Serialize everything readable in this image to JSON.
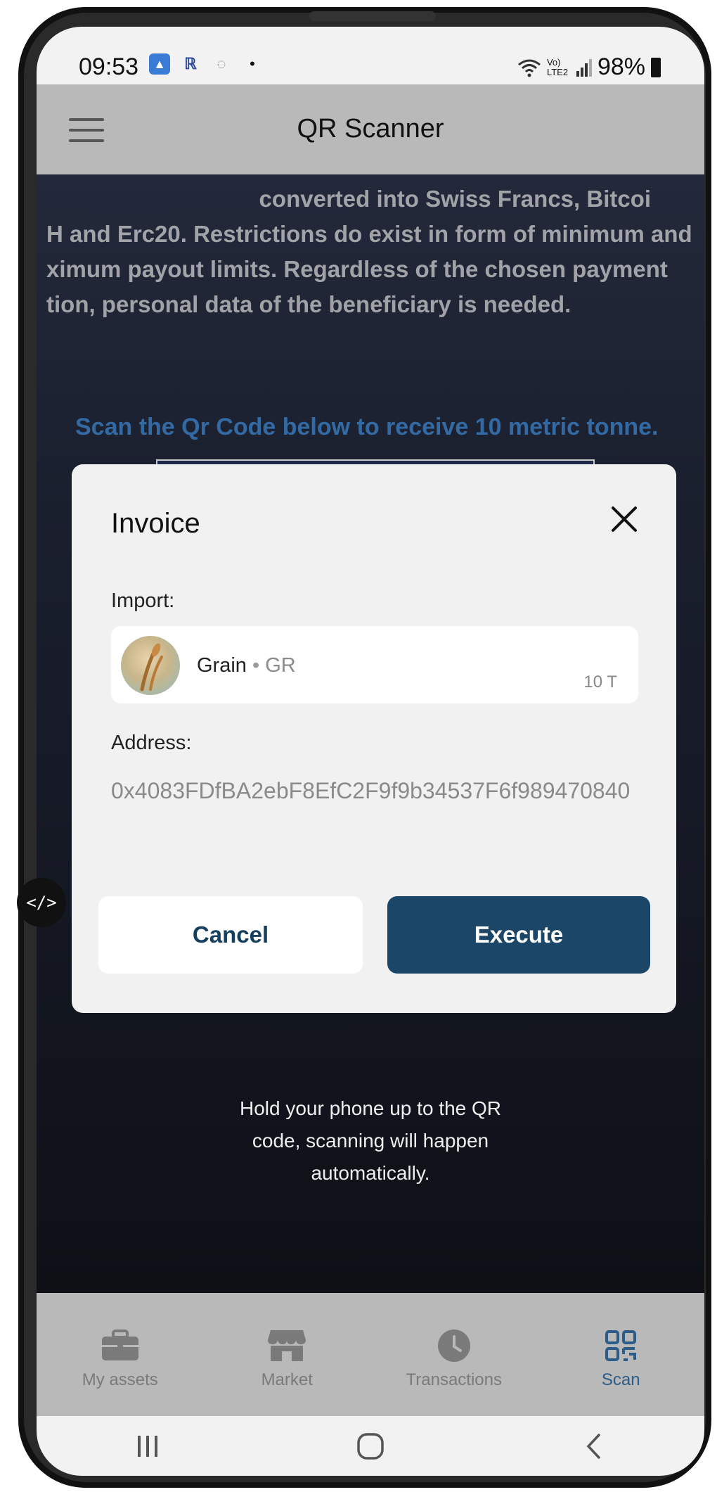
{
  "status_bar": {
    "time": "09:53",
    "network_label": "Vo) LTE2",
    "battery": "98%"
  },
  "app_bar": {
    "title": "QR Scanner"
  },
  "background": {
    "text_lines": [
      "                                 converted into Swiss Francs, Bitcoi",
      "H and Erc20. Restrictions do exist in form of minimum and",
      "ximum payout limits. Regardless of the chosen payment",
      "tion, personal data of the beneficiary is needed."
    ],
    "scan_hint": "Scan the Qr Code below to receive 10 metric tonne.",
    "hold_text": "Hold your phone up to the QR code, scanning will happen automatically."
  },
  "dialog": {
    "title": "Invoice",
    "import_label": "Import:",
    "asset": {
      "name": "Grain",
      "separator": "•",
      "symbol": "GR",
      "amount": "10 T"
    },
    "address_label": "Address:",
    "address": "0x4083FDfBA2ebF8EfC2F9f9b34537F6f989470840",
    "cancel_label": "Cancel",
    "execute_label": "Execute"
  },
  "dev_badge": "</>",
  "tabs": [
    {
      "label": "My assets",
      "icon": "briefcase-icon",
      "active": false
    },
    {
      "label": "Market",
      "icon": "store-icon",
      "active": false
    },
    {
      "label": "Transactions",
      "icon": "clock-icon",
      "active": false
    },
    {
      "label": "Scan",
      "icon": "qr-code-icon",
      "active": true
    }
  ],
  "colors": {
    "accent": "#1b4667",
    "active_tab": "#2b5c8a",
    "appbar": "#b9b9b9"
  }
}
